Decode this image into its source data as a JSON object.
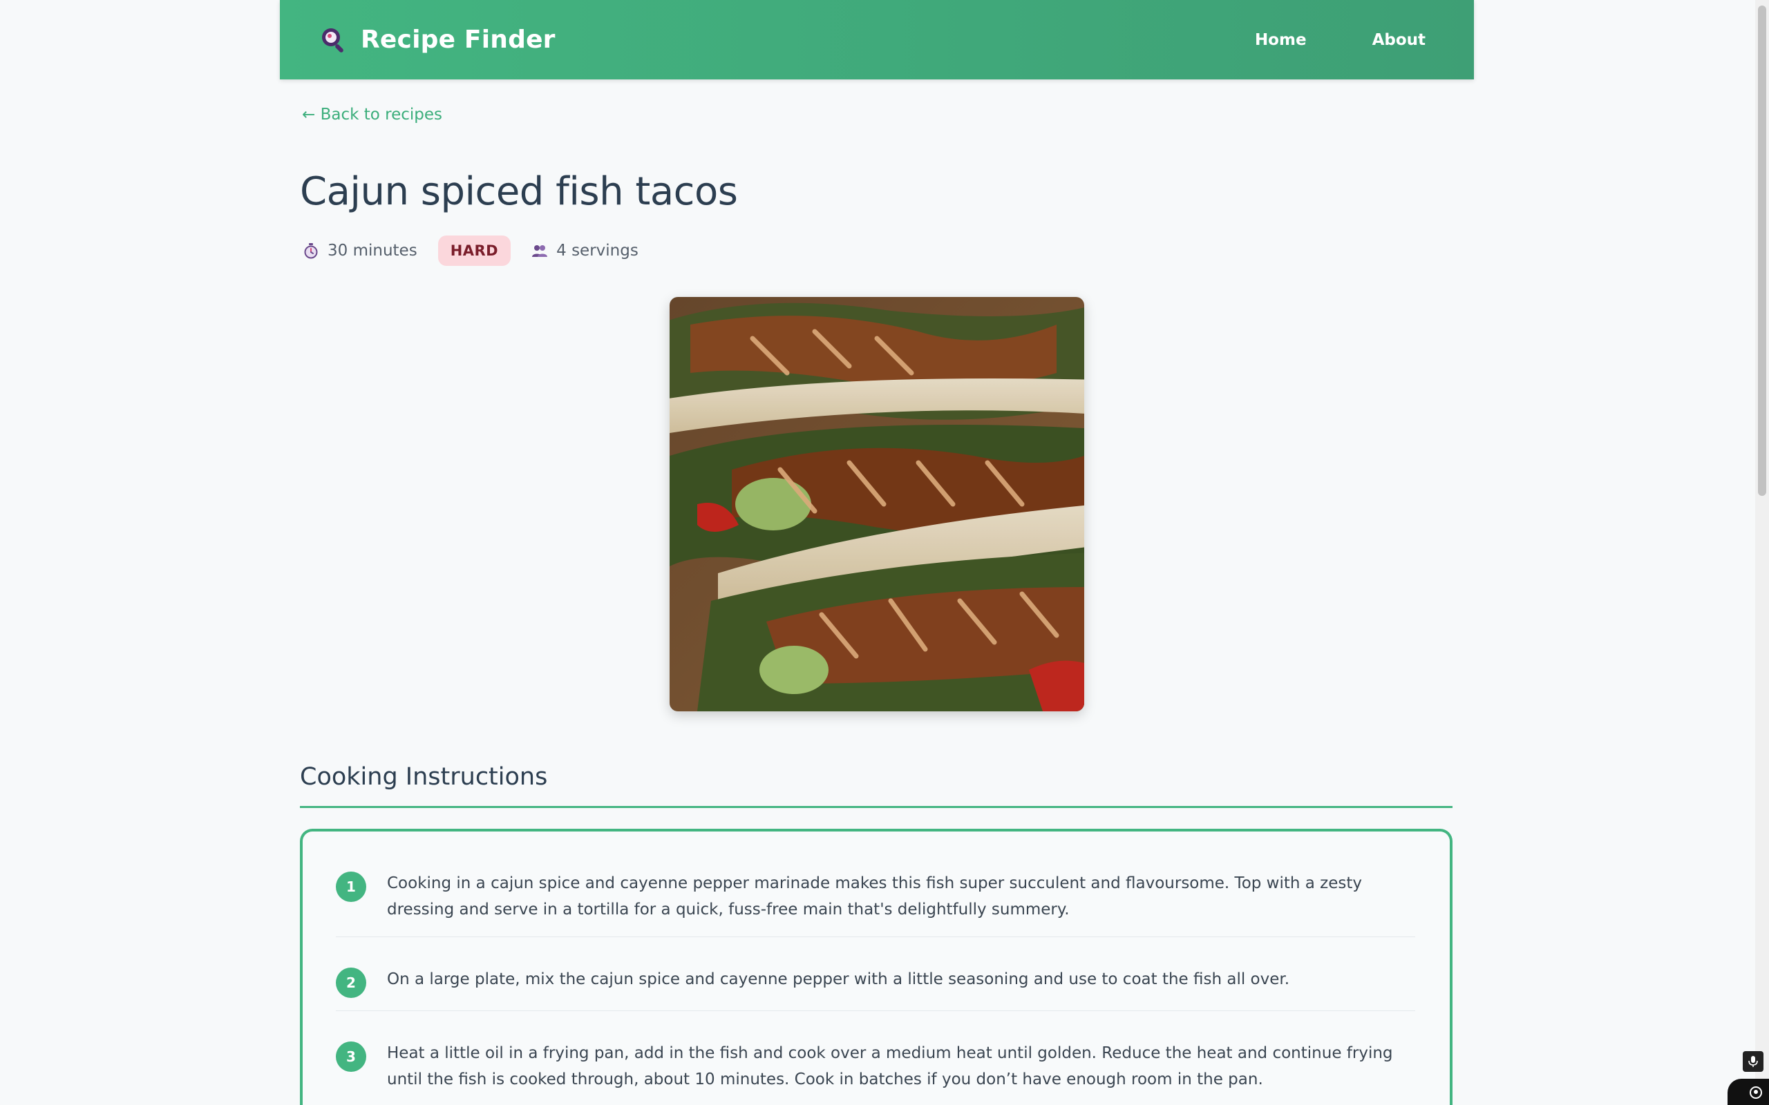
{
  "header": {
    "brand_title": "Recipe Finder",
    "brand_icon": "magnifier-logo-icon",
    "nav": {
      "home": "Home",
      "about": "About"
    }
  },
  "back_link": "← Back to recipes",
  "recipe": {
    "title": "Cajun spiced fish tacos",
    "time": "30 minutes",
    "difficulty": "HARD",
    "servings": "4 servings",
    "image_alt": "Cajun spiced fish tacos"
  },
  "instructions": {
    "heading": "Cooking Instructions",
    "steps": [
      {
        "num": "1",
        "text": "Cooking in a cajun spice and cayenne pepper marinade makes this fish super succulent and flavoursome. Top with a zesty dressing and serve in a tortilla for a quick, fuss-free main that's delightfully summery."
      },
      {
        "num": "2",
        "text": "On a large plate, mix the cajun spice and cayenne pepper with a little seasoning and use to coat the fish all over."
      },
      {
        "num": "3",
        "text": "Heat a little oil in a frying pan, add in the fish and cook over a medium heat until golden. Reduce the heat and continue frying until the fish is cooked through, about 10 minutes. Cook in batches if you don’t have enough room in the pan."
      }
    ]
  },
  "colors": {
    "accent": "#43b581",
    "badge_bg": "#fbd7dc",
    "badge_text": "#7a1d2a"
  }
}
